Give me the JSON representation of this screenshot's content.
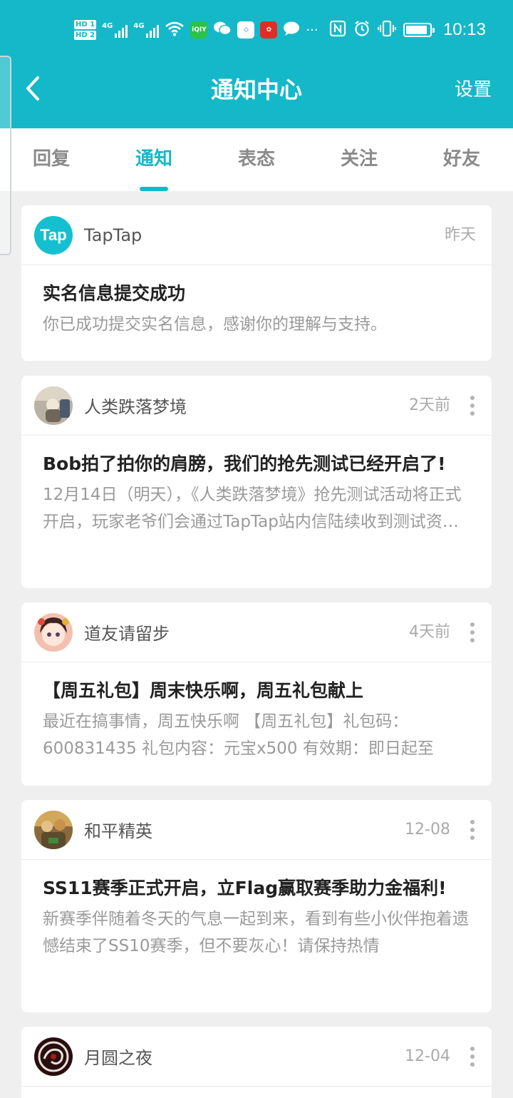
{
  "status_bar": {
    "sim1": "HD 1",
    "sim2": "HD 2",
    "net1": "4G",
    "net2": "4G",
    "overflow": "···",
    "time": "10:13",
    "battery_percent": 90,
    "icons": [
      "wifi-icon",
      "iqiyi-icon",
      "wechat-icon",
      "app-icon",
      "pinduoduo-icon",
      "chat-bubble-icon",
      "nfc-icon",
      "alarm-icon",
      "vibrate-icon",
      "battery-icon"
    ]
  },
  "header": {
    "title": "通知中心",
    "settings_label": "设置",
    "back_icon": "chevron-left-icon"
  },
  "tabs": [
    {
      "label": "回复",
      "active": false
    },
    {
      "label": "通知",
      "active": true
    },
    {
      "label": "表态",
      "active": false
    },
    {
      "label": "关注",
      "active": false
    },
    {
      "label": "好友",
      "active": false
    }
  ],
  "notifications": [
    {
      "source": "TapTap",
      "avatar_text": "Tap",
      "time": "昨天",
      "title": "实名信息提交成功",
      "desc": "你已成功提交实名信息，感谢你的理解与支持。"
    },
    {
      "source": "人类跌落梦境",
      "time": "2天前",
      "title": "Bob拍了拍你的肩膀，我们的抢先测试已经开启了!",
      "desc": "12月14日（明天），《人类跌落梦境》抢先测试活动将正式开启，玩家老爷们会通过TapTap站内信陆续收到测试资格通知"
    },
    {
      "source": "道友请留步",
      "time": "4天前",
      "title": "【周五礼包】周末快乐啊，周五礼包献上",
      "desc": "最近在搞事情，周五快乐啊 【周五礼包】礼包码：600831435 礼包内容：元宝x500 有效期：即日起至"
    },
    {
      "source": "和平精英",
      "time": "12-08",
      "title": "SS11赛季正式开启，立Flag赢取赛季助力金福利!",
      "desc": "新赛季伴随着冬天的气息一起到来，看到有些小伙伴抱着遗憾结束了SS10赛季，但不要灰心！请保持热情"
    },
    {
      "source": "月圆之夜",
      "time": "12-04"
    }
  ],
  "colors": {
    "brand": "#15b8c8",
    "background": "#efefef"
  }
}
